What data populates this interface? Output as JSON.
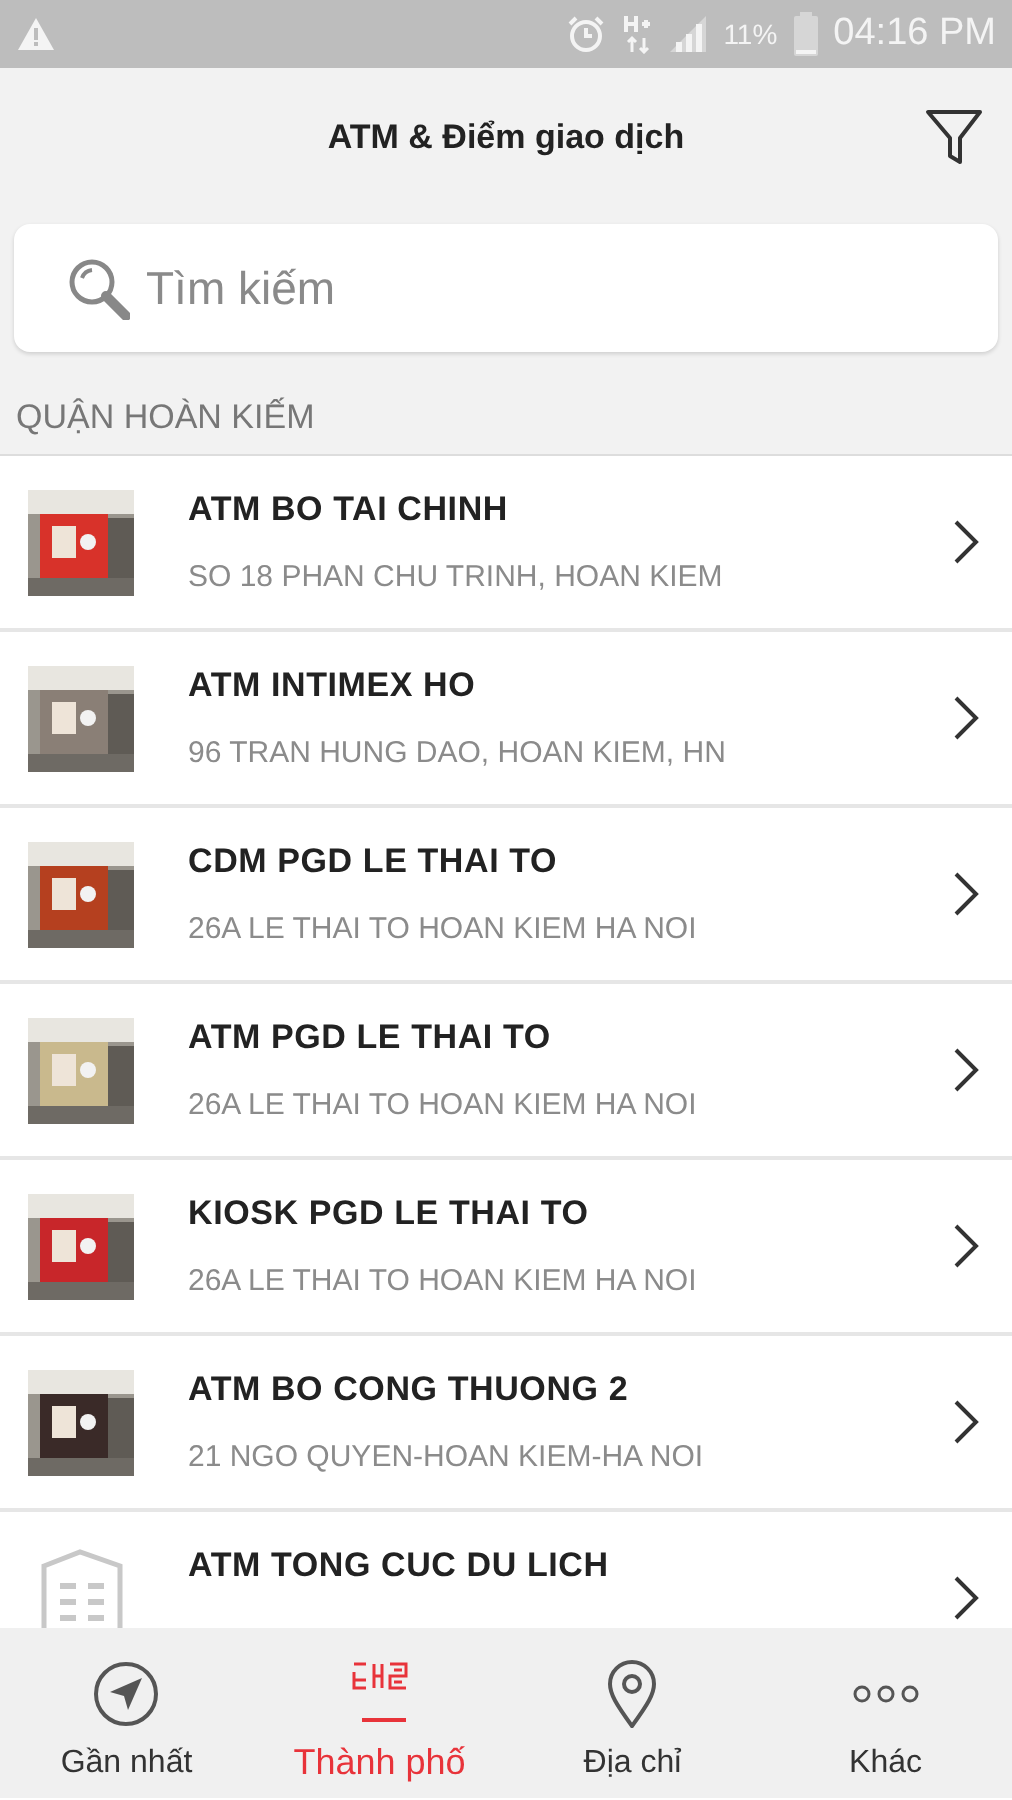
{
  "status_bar": {
    "battery": "11%",
    "time": "04:16 PM"
  },
  "header": {
    "title": "ATM & Điểm giao dịch"
  },
  "search": {
    "placeholder": "Tìm kiếm"
  },
  "section": {
    "title": "QUẬN HOÀN KIẾM"
  },
  "locations": [
    {
      "name": "ATM BO TAI CHINH",
      "address": "SO 18 PHAN CHU TRINH, HOAN KIEM"
    },
    {
      "name": "ATM INTIMEX HO",
      "address": "96 TRAN HUNG DAO, HOAN KIEM, HN"
    },
    {
      "name": "CDM PGD LE THAI TO",
      "address": "26A LE THAI TO HOAN KIEM HA NOI"
    },
    {
      "name": "ATM PGD LE THAI TO",
      "address": "26A LE THAI TO HOAN KIEM HA NOI"
    },
    {
      "name": "KIOSK PGD LE THAI TO",
      "address": "26A LE THAI TO HOAN KIEM HA NOI"
    },
    {
      "name": "ATM BO CONG THUONG 2",
      "address": "21 NGO QUYEN-HOAN KIEM-HA NOI"
    },
    {
      "kind": "placeholder",
      "name": "ATM TONG CUC DU LICH"
    }
  ],
  "tabs": [
    {
      "kind": "nearest",
      "label": "Gần nhất",
      "selected": false
    },
    {
      "kind": "city",
      "label": "Thành phố",
      "selected": true
    },
    {
      "kind": "address",
      "label": "Địa chỉ",
      "selected": false
    },
    {
      "kind": "more",
      "label": "Khác",
      "selected": false
    }
  ]
}
